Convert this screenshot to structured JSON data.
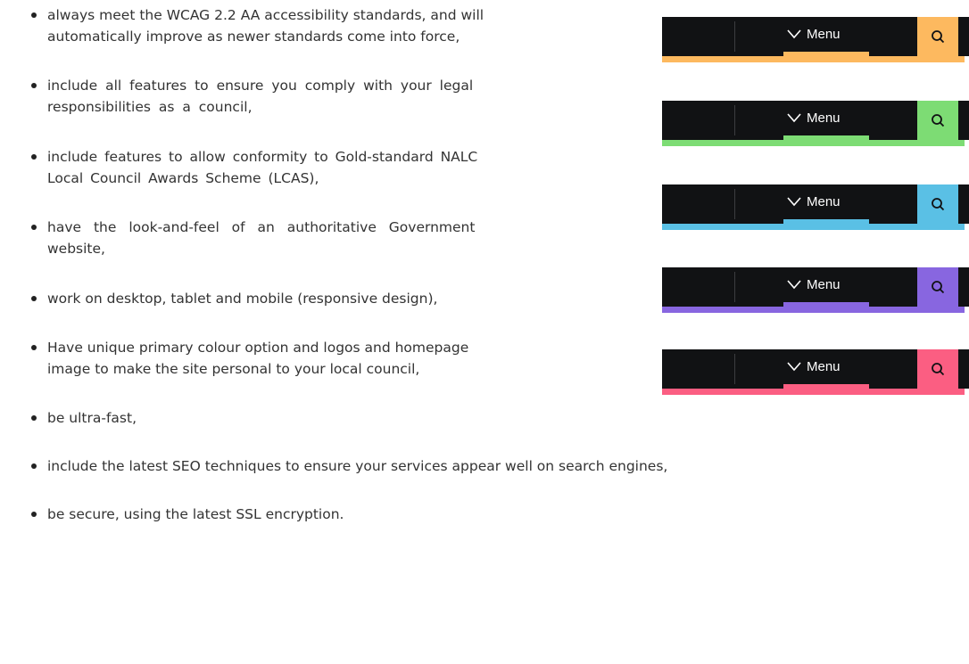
{
  "features": [
    {
      "lines": [
        "always meet the WCAG 2.2 AA accessibility standards, and will",
        "automatically improve as newer standards come into force,"
      ]
    },
    {
      "lines": [
        "include all features to ensure you comply with your legal",
        "responsibilities as a council,"
      ]
    },
    {
      "lines": [
        "include features to allow conformity to Gold-standard NALC",
        "Local Council Awards Scheme (LCAS),"
      ]
    },
    {
      "lines": [
        "have the look-and-feel of an authoritative Government",
        "website,"
      ]
    },
    {
      "lines": [
        "work on desktop, tablet and mobile (responsive design),"
      ]
    },
    {
      "lines": [
        "Have unique primary colour option and logos and homepage",
        "image to make the site personal to your local council,"
      ]
    },
    {
      "lines": [
        "be ultra-fast,"
      ]
    },
    {
      "lines": [
        "include the latest SEO techniques to ensure your services appear well on search engines,"
      ]
    },
    {
      "lines": [
        "be secure, using the latest SSL encryption."
      ]
    }
  ],
  "header_bars": [
    {
      "menu_label": "Menu",
      "accent": "#FDB95F",
      "menu_icon": "chevron-down-icon",
      "search_icon": "search-icon"
    },
    {
      "menu_label": "Menu",
      "accent": "#7DDC74",
      "menu_icon": "chevron-down-icon",
      "search_icon": "search-icon"
    },
    {
      "menu_label": "Menu",
      "accent": "#5AC0E5",
      "menu_icon": "chevron-down-icon",
      "search_icon": "search-icon"
    },
    {
      "menu_label": "Menu",
      "accent": "#8866E0",
      "menu_icon": "chevron-down-icon",
      "search_icon": "search-icon"
    },
    {
      "menu_label": "Menu",
      "accent": "#FB5E82",
      "menu_icon": "chevron-down-icon",
      "search_icon": "search-icon"
    }
  ]
}
